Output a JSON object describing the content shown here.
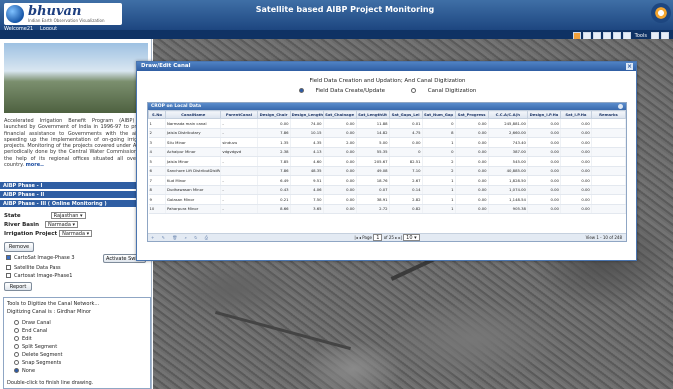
{
  "header": {
    "brand_name": "bhuvan",
    "brand_sub": "Indian Earth Observation Visualization",
    "title": "Satellite based AIBP Project Monitoring",
    "welcome": "Welcome21",
    "logout": "Logout",
    "tools_label": "Tools"
  },
  "left": {
    "intro_text": "Accelerated Irrigation Benefit Program (AIBP) was launched by Government of India in 1996-97 to provide financial assistance to Governments with the aim of speeding up the implementation of on-going irrigation projects. Monitoring of the projects covered under AIBP is periodically done by the Central Water Commission with the help of its regional offices situated all over the country.",
    "more_link": "more..",
    "phases": [
      "AIBP Phase - I",
      "AIBP Phase - II",
      "AIBP Phase - III ( Online Monitoring )"
    ],
    "state_label": "State",
    "state_value": "Rajasthan",
    "basin_label": "River Basin",
    "basin_value": "Narmada",
    "project_label": "Irrigation Project",
    "project_value": "Narmada",
    "remove_button": "Remove",
    "layers": [
      {
        "label": "CartoSat Image-Phase 3",
        "checked": true
      },
      {
        "label": "Satellite Data Pass",
        "checked": false
      },
      {
        "label": "Cartosat Image-Phase1",
        "checked": false
      }
    ],
    "activate_swipe": "Activate Swipe",
    "report_button": "Report",
    "digitize_title": "Tools to Digitize the Canal Network...",
    "digitize_canal": "Digitizing Canal is : Girdhar Minor",
    "digitize_options": [
      {
        "label": "Draw Canal",
        "selected": false
      },
      {
        "label": "End Canal",
        "selected": false
      },
      {
        "label": "Edit",
        "selected": false
      },
      {
        "label": "Split Segment",
        "selected": false
      },
      {
        "label": "Delete Segment",
        "selected": false
      },
      {
        "label": "Snap Segments",
        "selected": false
      },
      {
        "label": "None",
        "selected": true
      }
    ],
    "digitize_hint": "Double-click to finish line drawing."
  },
  "dialog": {
    "title": "Draw/Edit Canal",
    "heading": "Field Data Creation and Updation; And Canal Digitization",
    "options": [
      {
        "label": "Field Data Create/Update",
        "selected": true
      },
      {
        "label": "Canal Digitization",
        "selected": false
      }
    ],
    "grid_title": "CROP on Local Data",
    "columns": [
      "S.No",
      "CanalName",
      "ParentCanal",
      "Design_Chair",
      "Design_Length",
      "Sat_Chainage",
      "Sat_LengthUt",
      "Sat_Gaps_Lei",
      "Sat_Num_Gap",
      "Sat_Progress",
      "C.C.A/C.A(h",
      "Design_I.P.Ha",
      "Sat_I.P.Ha",
      "Remarks"
    ],
    "rows": [
      [
        "1",
        "Narmada main canal",
        "-",
        "0.00",
        "74.00",
        "0.00",
        "11.88",
        "0.01",
        "0",
        "0.00",
        "245,881.00",
        "0.00",
        "0.00",
        ""
      ],
      [
        "2",
        "Jaisla Distributary",
        "-",
        "7.86",
        "10.15",
        "0.00",
        "14.82",
        "4.75",
        "8",
        "0.00",
        "2,660.00",
        "0.00",
        "0.00",
        ""
      ],
      [
        "3",
        "Silu Minor",
        "sinduvu",
        "1.35",
        "4.35",
        "2.00",
        "5.00",
        "0.00",
        "1",
        "0.00",
        "743.40",
        "0.00",
        "0.00",
        ""
      ],
      [
        "4",
        "Achalpur Minor",
        "vdgvdgvd",
        "2.38",
        "4.13",
        "0.00",
        "55.35",
        "0",
        "0",
        "0.00",
        "387.00",
        "0.00",
        "0.00",
        ""
      ],
      [
        "5",
        "Jaisla Minor",
        "-",
        "7.85",
        "4.60",
        "0.00",
        "205.67",
        "82.51",
        "2",
        "0.00",
        "545.00",
        "0.00",
        "0.00",
        ""
      ],
      [
        "6",
        "Sanchore Lift DistributDistRoy",
        "",
        "7.86",
        "48.35",
        "0.00",
        "49.08",
        "7.10",
        "2",
        "0.00",
        "40,885.00",
        "0.00",
        "0.00",
        ""
      ],
      [
        "7",
        "Kud Minor",
        "-",
        "6.49",
        "9.51",
        "0.00",
        "18.76",
        "2.67",
        "1",
        "0.00",
        "1,828.50",
        "0.00",
        "0.00",
        ""
      ],
      [
        "8",
        "Dudhawasan Minor",
        "-",
        "0.43",
        "4.06",
        "0.00",
        "0.07",
        "0.14",
        "1",
        "0.00",
        "1,074.00",
        "0.00",
        "0.00",
        ""
      ],
      [
        "9",
        "Golasan Minor",
        "-",
        "0.21",
        "7.50",
        "0.00",
        "38.91",
        "2.82",
        "1",
        "0.00",
        "1,148.54",
        "0.00",
        "0.00",
        ""
      ],
      [
        "10",
        "Paharpura Minor",
        "-",
        "8.66",
        "3.65",
        "0.00",
        "2.72",
        "0.82",
        "1",
        "0.00",
        "905.38",
        "0.00",
        "0.00",
        ""
      ]
    ],
    "pager": {
      "page_text": "Page",
      "page": "1",
      "of_text": "of 25",
      "per_page": "10",
      "view_text": "View 1 - 10 of 248"
    }
  }
}
